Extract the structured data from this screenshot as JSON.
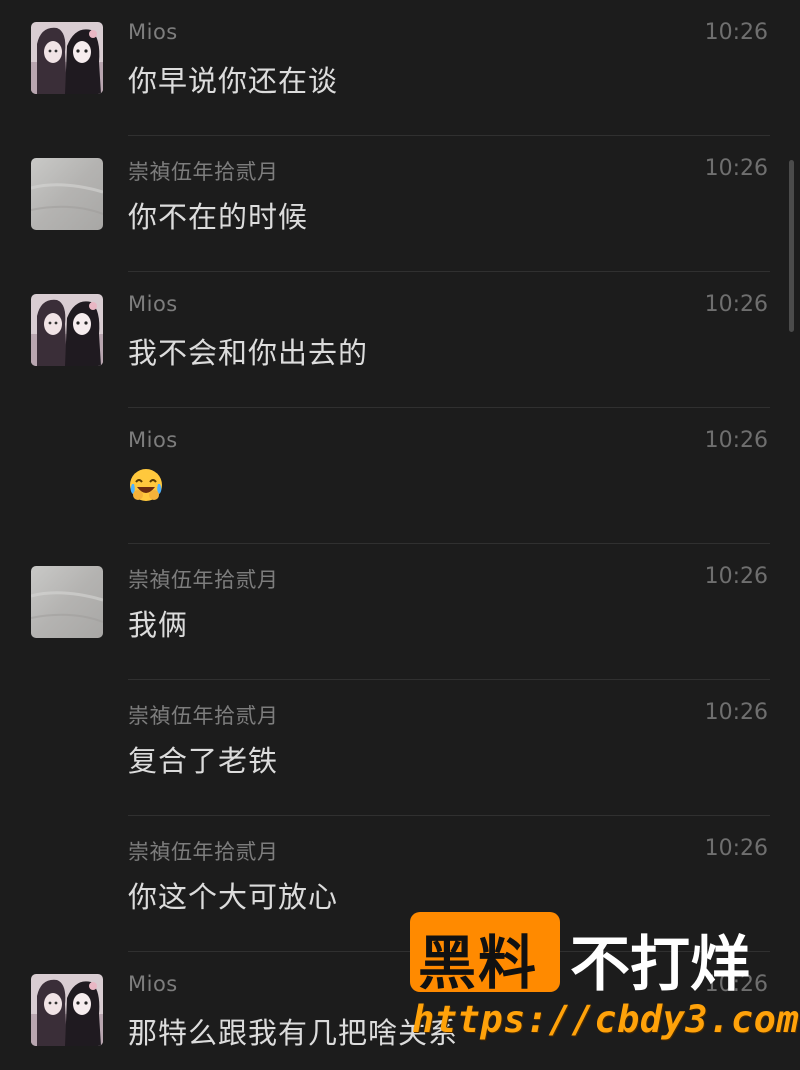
{
  "messages": [
    {
      "sender": "Mios",
      "time": "10:26",
      "text": "你早说你还在谈",
      "avatar": "anime-avatar"
    },
    {
      "sender": "崇禎伍年拾贰月",
      "time": "10:26",
      "text": "你不在的时候",
      "avatar": "gray-avatar"
    },
    {
      "sender": "Mios",
      "time": "10:26",
      "text": "我不会和你出去的",
      "avatar": "anime-avatar"
    },
    {
      "sender": "Mios",
      "time": "10:26",
      "text": "",
      "emoji": "crying-laughing-emoji",
      "avatar": ""
    },
    {
      "sender": "崇禎伍年拾贰月",
      "time": "10:26",
      "text": "我俩",
      "avatar": "gray-avatar"
    },
    {
      "sender": "崇禎伍年拾贰月",
      "time": "10:26",
      "text": "复合了老铁",
      "avatar": ""
    },
    {
      "sender": "崇禎伍年拾贰月",
      "time": "10:26",
      "text": "你这个大可放心",
      "avatar": ""
    },
    {
      "sender": "Mios",
      "time": "10:26",
      "text": "那特么跟我有几把啥关系",
      "avatar": "anime-avatar"
    }
  ],
  "watermark": {
    "brand": "黑料",
    "slogan": "不打烊",
    "url": "https://cbdy3.com"
  },
  "colors": {
    "background": "#1c1c1c",
    "text": "#dcdcdc",
    "meta": "#7d7d7d",
    "watermark_accent": "#ff8a00"
  }
}
